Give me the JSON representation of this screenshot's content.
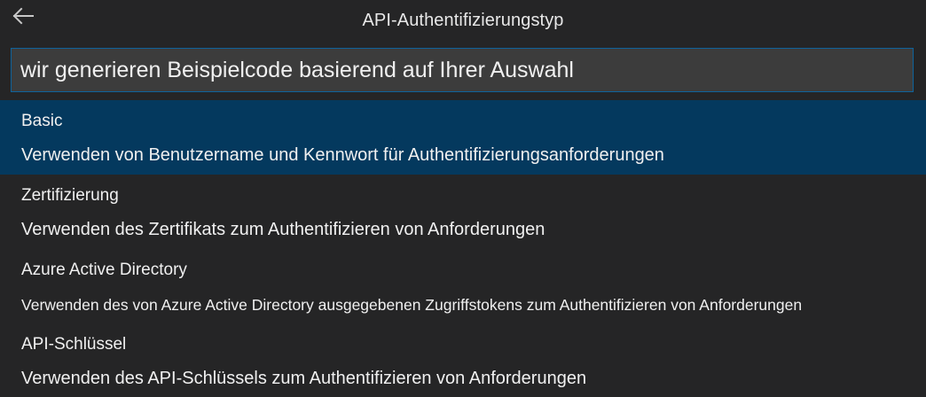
{
  "header": {
    "title": "API-Authentifizierungstyp",
    "back_icon": "arrow-left-icon"
  },
  "search": {
    "value": "wir generieren Beispielcode basierend auf Ihrer Auswahl",
    "placeholder": ""
  },
  "colors": {
    "background": "#252526",
    "selected": "#04395e",
    "input_border": "#0e639c",
    "input_bg": "#3c3c3c"
  },
  "options": [
    {
      "label": "Basic",
      "description": "Verwenden von Benutzername und Kennwort für Authentifizierungsanforderungen",
      "selected": true
    },
    {
      "label": "Zertifizierung",
      "description": "Verwenden des Zertifikats zum Authentifizieren von Anforderungen",
      "selected": false
    },
    {
      "label": "Azure Active Directory",
      "description": "Verwenden des von Azure Active Directory ausgegebenen Zugriffstokens zum Authentifizieren von Anforderungen",
      "selected": false
    },
    {
      "label": "API-Schlüssel",
      "description": "Verwenden des API-Schlüssels zum Authentifizieren von Anforderungen",
      "selected": false
    }
  ]
}
